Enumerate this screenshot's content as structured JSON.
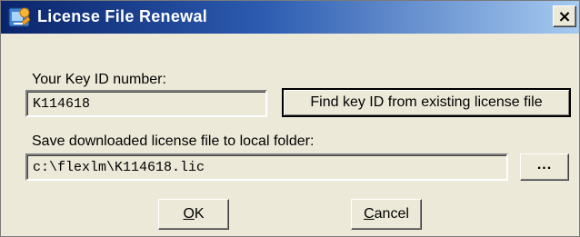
{
  "window": {
    "title": "License File Renewal",
    "close_label": "×"
  },
  "key_id": {
    "label": "Your Key ID number:",
    "value": "K114618",
    "find_button_label": "Find key ID from existing license file"
  },
  "save_folder": {
    "label": "Save downloaded license file to local folder:",
    "value": "c:\\flexlm\\K114618.lic",
    "browse_label": "..."
  },
  "buttons": {
    "ok_accel": "O",
    "ok_rest": "K",
    "cancel_accel": "C",
    "cancel_rest": "ancel"
  },
  "colors": {
    "titlebar_start": "#0a246a",
    "titlebar_end": "#a6caf0",
    "dialog_bg": "#ece9d8"
  }
}
